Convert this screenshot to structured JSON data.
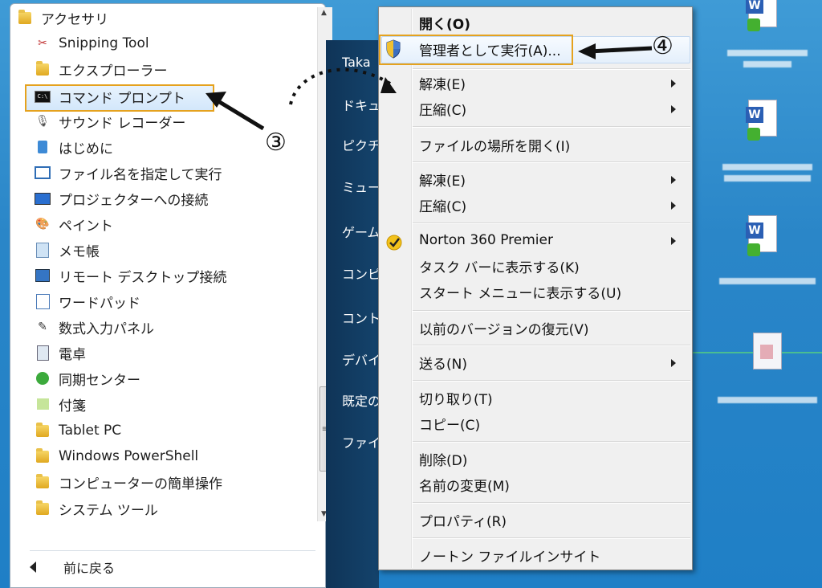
{
  "programs": {
    "folder_title": "アクセサリ",
    "items": [
      {
        "label": "Snipping Tool",
        "icon": "scissors-icon"
      },
      {
        "label": "エクスプローラー",
        "icon": "folder-explorer-icon"
      },
      {
        "label": "コマンド プロンプト",
        "icon": "cmd-icon"
      },
      {
        "label": "サウンド レコーダー",
        "icon": "microphone-icon"
      },
      {
        "label": "はじめに",
        "icon": "getting-started-icon"
      },
      {
        "label": "ファイル名を指定して実行",
        "icon": "run-icon"
      },
      {
        "label": "プロジェクターへの接続",
        "icon": "projector-icon"
      },
      {
        "label": "ペイント",
        "icon": "paint-icon"
      },
      {
        "label": "メモ帳",
        "icon": "notepad-icon"
      },
      {
        "label": "リモート デスクトップ接続",
        "icon": "remote-desktop-icon"
      },
      {
        "label": "ワードパッド",
        "icon": "wordpad-icon"
      },
      {
        "label": "数式入力パネル",
        "icon": "math-input-icon"
      },
      {
        "label": "電卓",
        "icon": "calculator-icon"
      },
      {
        "label": "同期センター",
        "icon": "sync-center-icon"
      },
      {
        "label": "付箋",
        "icon": "sticky-notes-icon"
      },
      {
        "label": "Tablet PC",
        "icon": "folder-icon"
      },
      {
        "label": "Windows PowerShell",
        "icon": "folder-icon"
      },
      {
        "label": "コンピューターの簡単操作",
        "icon": "folder-icon"
      },
      {
        "label": "システム ツール",
        "icon": "folder-icon"
      }
    ],
    "back_label": "前に戻る"
  },
  "start_right": {
    "items": [
      "Taka",
      "ドキュ",
      "ピクチ",
      "ミュー",
      "ゲーム",
      "コンピ",
      "コント",
      "デバイ",
      "既定の",
      "ファイ"
    ]
  },
  "context_menu": {
    "items": [
      {
        "label": "開く(O)",
        "bold": true
      },
      {
        "label": "管理者として実行(A)..."
      },
      {
        "label": "解凍(E)",
        "submenu": true
      },
      {
        "label": "圧縮(C)",
        "submenu": true
      },
      {
        "label": "ファイルの場所を開く(I)"
      },
      {
        "label": "解凍(E)",
        "submenu": true
      },
      {
        "label": "圧縮(C)",
        "submenu": true
      },
      {
        "label": "Norton 360 Premier",
        "submenu": true
      },
      {
        "label": "タスク バーに表示する(K)"
      },
      {
        "label": "スタート メニューに表示する(U)"
      },
      {
        "label": "以前のバージョンの復元(V)"
      },
      {
        "label": "送る(N)",
        "submenu": true
      },
      {
        "label": "切り取り(T)"
      },
      {
        "label": "コピー(C)"
      },
      {
        "label": "削除(D)"
      },
      {
        "label": "名前の変更(M)"
      },
      {
        "label": "プロパティ(R)"
      },
      {
        "label": "ノートン ファイルインサイト"
      }
    ]
  },
  "annotations": {
    "step3": "③",
    "step4": "④"
  },
  "colors": {
    "highlight_border": "#e5a21e",
    "desktop": "#2a86c8"
  }
}
